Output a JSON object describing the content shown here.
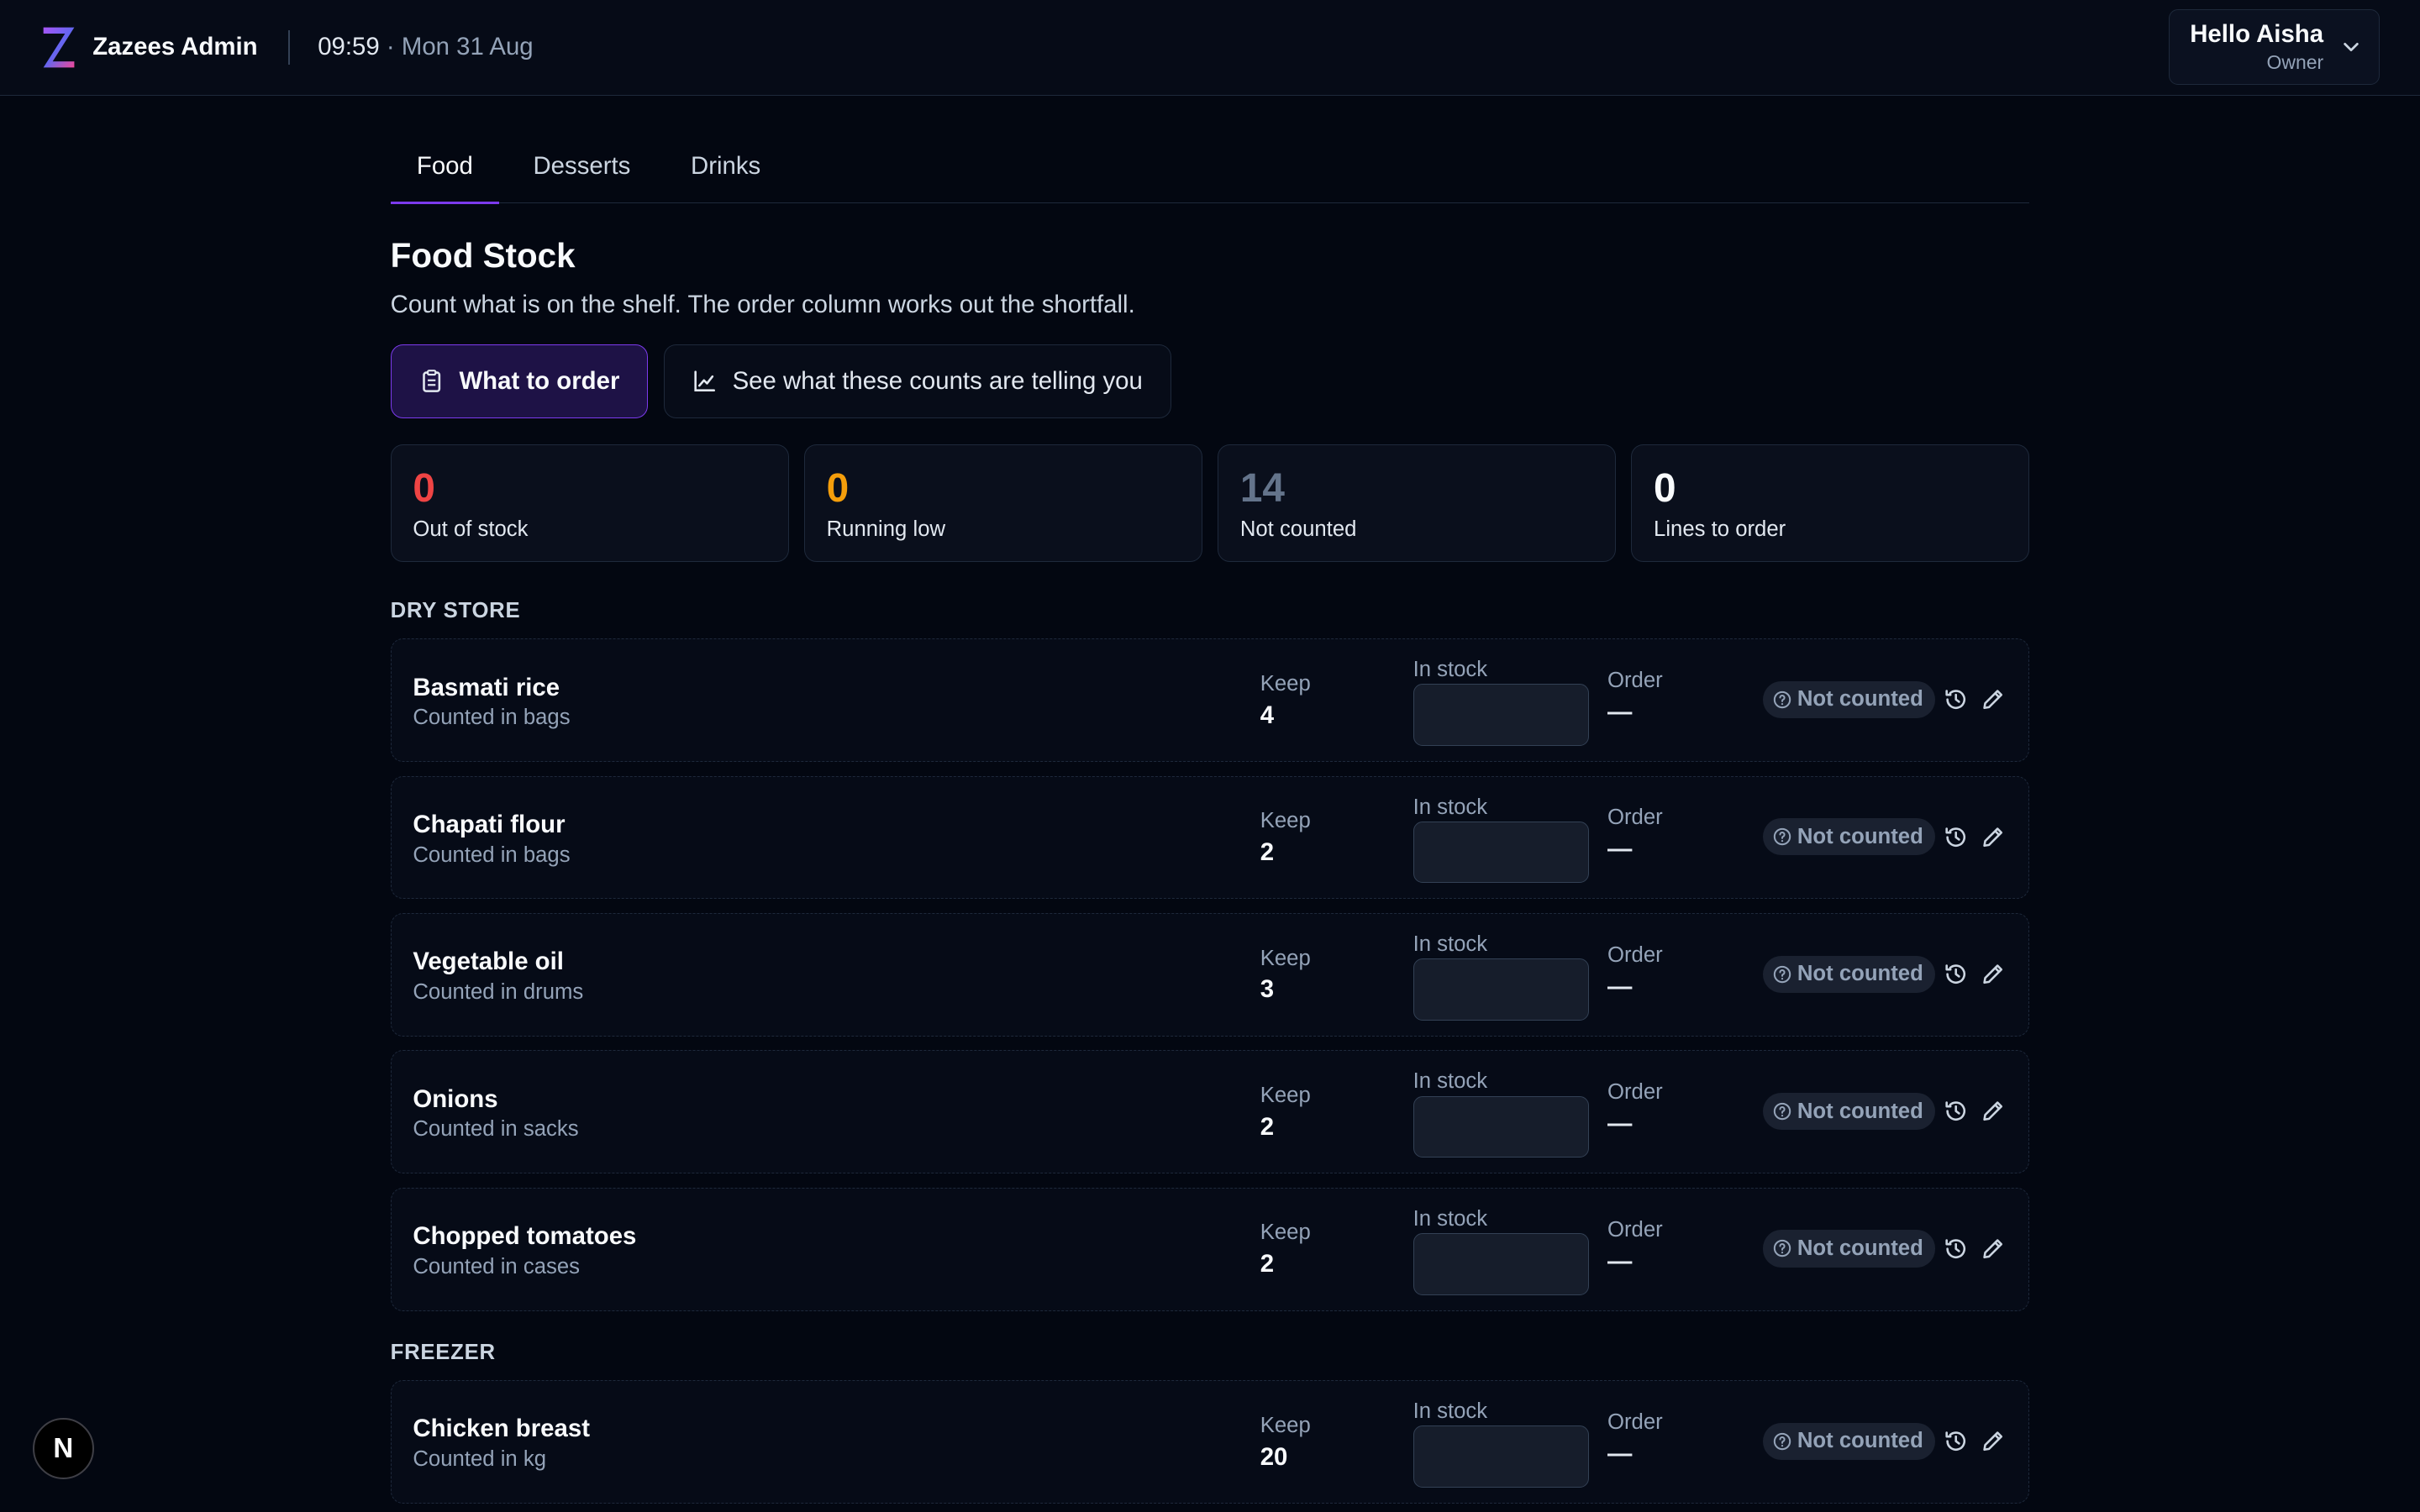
{
  "header": {
    "brand": "Zazees Admin",
    "time": "09:59",
    "date": "· Mon 31 Aug",
    "user_greeting": "Hello Aisha",
    "user_role": "Owner"
  },
  "tabs": [
    {
      "label": "Food",
      "active": true
    },
    {
      "label": "Desserts",
      "active": false
    },
    {
      "label": "Drinks",
      "active": false
    }
  ],
  "page": {
    "title": "Food Stock",
    "subtitle": "Count what is on the shelf. The order column works out the shortfall."
  },
  "actions": {
    "what_to_order": "What to order",
    "see_counts": "See what these counts are telling you"
  },
  "stats": [
    {
      "value": "0",
      "label": "Out of stock",
      "color": "#ef4444"
    },
    {
      "value": "0",
      "label": "Running low",
      "color": "#f59e0b"
    },
    {
      "value": "14",
      "label": "Not counted",
      "color": "#64748b"
    },
    {
      "value": "0",
      "label": "Lines to order",
      "color": "#f8fafc"
    }
  ],
  "labels": {
    "keep": "Keep",
    "in_stock": "In stock",
    "order": "Order",
    "status": "Not counted",
    "order_empty": "—"
  },
  "sections": [
    {
      "title": "DRY STORE",
      "items": [
        {
          "name": "Basmati rice",
          "unit": "Counted in bags",
          "keep": "4"
        },
        {
          "name": "Chapati flour",
          "unit": "Counted in bags",
          "keep": "2"
        },
        {
          "name": "Vegetable oil",
          "unit": "Counted in drums",
          "keep": "3"
        },
        {
          "name": "Onions",
          "unit": "Counted in sacks",
          "keep": "2"
        },
        {
          "name": "Chopped tomatoes",
          "unit": "Counted in cases",
          "keep": "2"
        }
      ]
    },
    {
      "title": "FREEZER",
      "items": [
        {
          "name": "Chicken breast",
          "unit": "Counted in kg",
          "keep": "20"
        }
      ]
    }
  ],
  "dev_badge": "N"
}
